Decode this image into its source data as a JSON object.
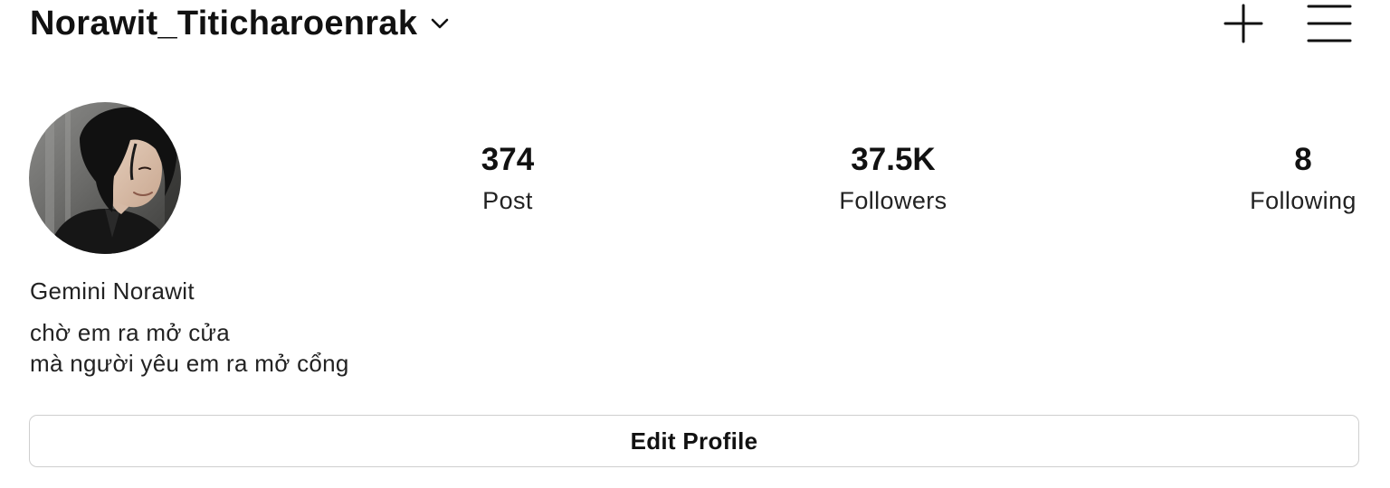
{
  "header": {
    "username": "Norawit_Titicharoenrak",
    "dropdown_icon": "chevron-down-icon",
    "create_icon": "plus-icon",
    "menu_icon": "hamburger-menu-icon"
  },
  "profile": {
    "avatar_icon": "profile-photo",
    "stats": [
      {
        "value": "374",
        "label": "Post"
      },
      {
        "value": "37.5K",
        "label": "Followers"
      },
      {
        "value": "8",
        "label": "Following"
      }
    ],
    "display_name": "Gemini Norawit",
    "bio_lines": [
      "chờ em ra mở cửa",
      "mà người yêu em ra mở cổng"
    ],
    "edit_button_label": "Edit Profile"
  },
  "colors": {
    "text": "#111111",
    "border": "#cfcfcf",
    "background": "#ffffff"
  }
}
